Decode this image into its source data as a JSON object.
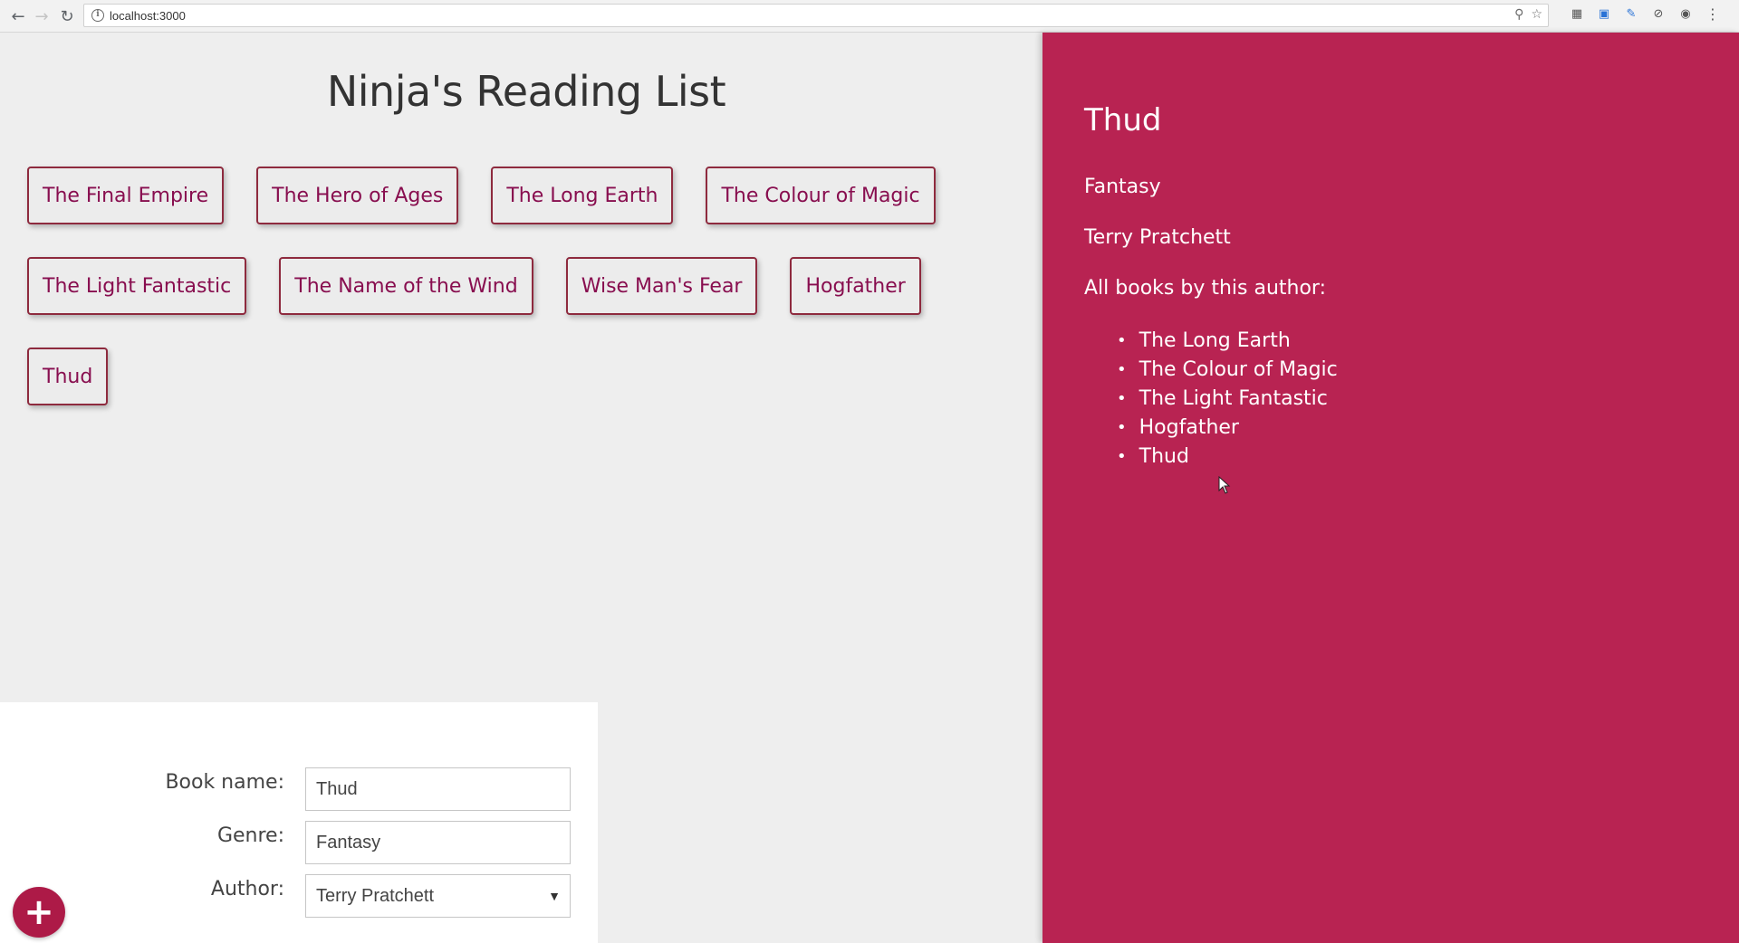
{
  "browser": {
    "url": "localhost:3000"
  },
  "page": {
    "title": "Ninja's Reading List"
  },
  "books": [
    "The Final Empire",
    "The Hero of Ages",
    "The Long Earth",
    "The Colour of Magic",
    "The Light Fantastic",
    "The Name of the Wind",
    "Wise Man's Fear",
    "Hogfather",
    "Thud"
  ],
  "details": {
    "title": "Thud",
    "genre": "Fantasy",
    "author": "Terry Pratchett",
    "all_books_label": "All books by this author:",
    "author_books": [
      "The Long Earth",
      "The Colour of Magic",
      "The Light Fantastic",
      "Hogfather",
      "Thud"
    ]
  },
  "form": {
    "book_name_label": "Book name:",
    "book_name_value": "Thud",
    "genre_label": "Genre:",
    "genre_value": "Fantasy",
    "author_label": "Author:",
    "author_value": "Terry Pratchett",
    "add_label": "+"
  },
  "colors": {
    "accent": "#b82352",
    "button_text": "#880e4f",
    "button_border": "#8e2a3e"
  }
}
